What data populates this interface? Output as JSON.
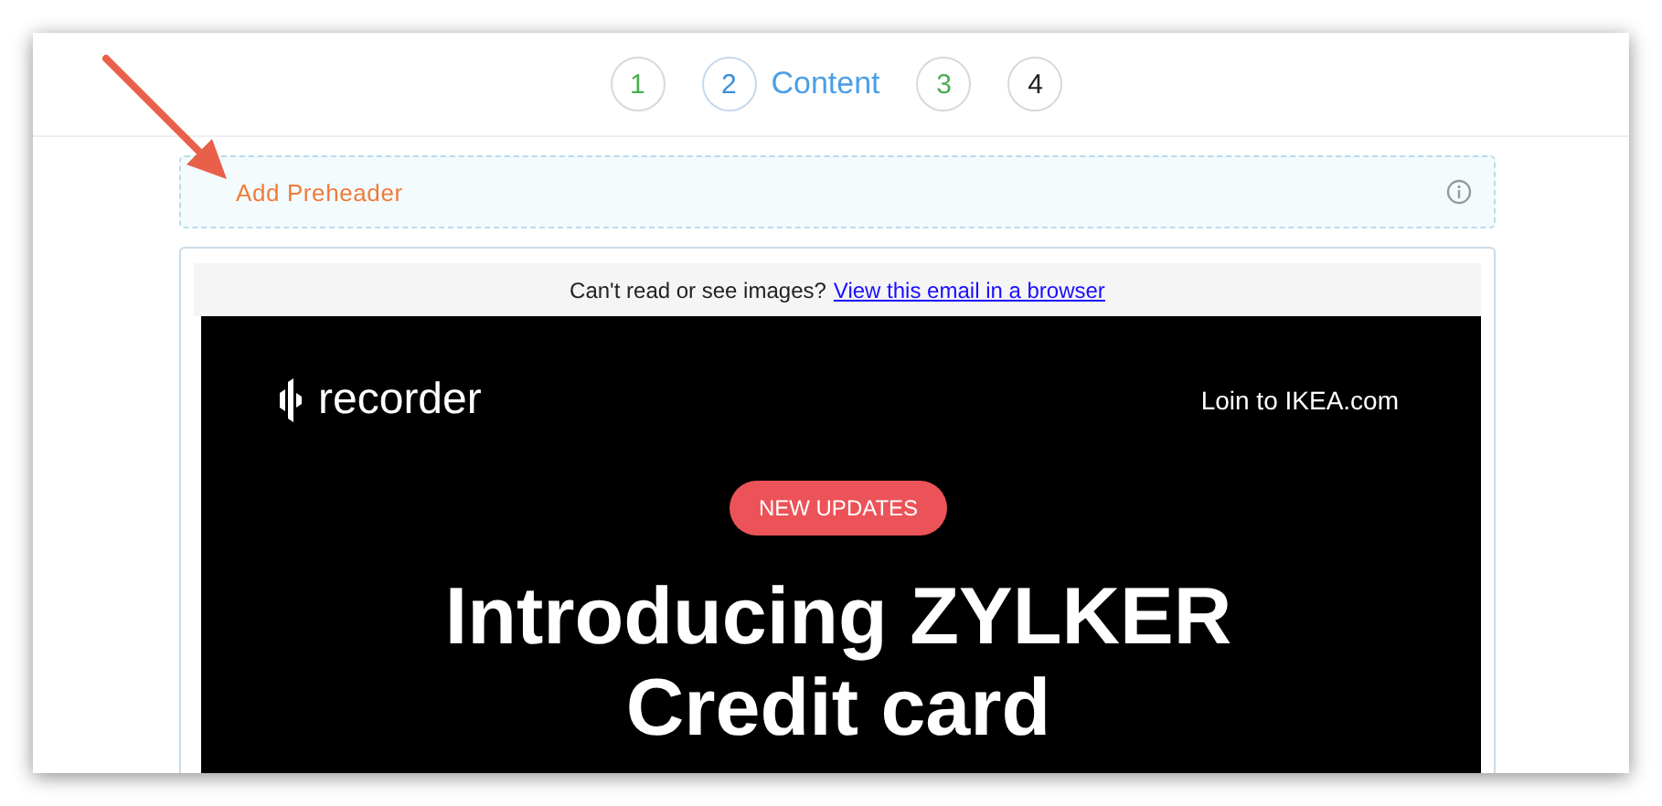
{
  "steps": [
    {
      "number": "1",
      "kind": "done",
      "selected": false
    },
    {
      "number": "2",
      "kind": "current",
      "selected": true,
      "label": "Content"
    },
    {
      "number": "3",
      "kind": "done",
      "selected": false
    },
    {
      "number": "4",
      "kind": "pending",
      "selected": false
    }
  ],
  "preheader": {
    "label": "Add Preheader"
  },
  "email": {
    "notice": "Can't read or see images?",
    "browser_link": "View this email in a browser",
    "brand": "recorder",
    "login_link": "Loin to IKEA.com",
    "badge": "NEW UPDATES",
    "headline": [
      "Introducing ZYLKER",
      "Credit card"
    ]
  }
}
